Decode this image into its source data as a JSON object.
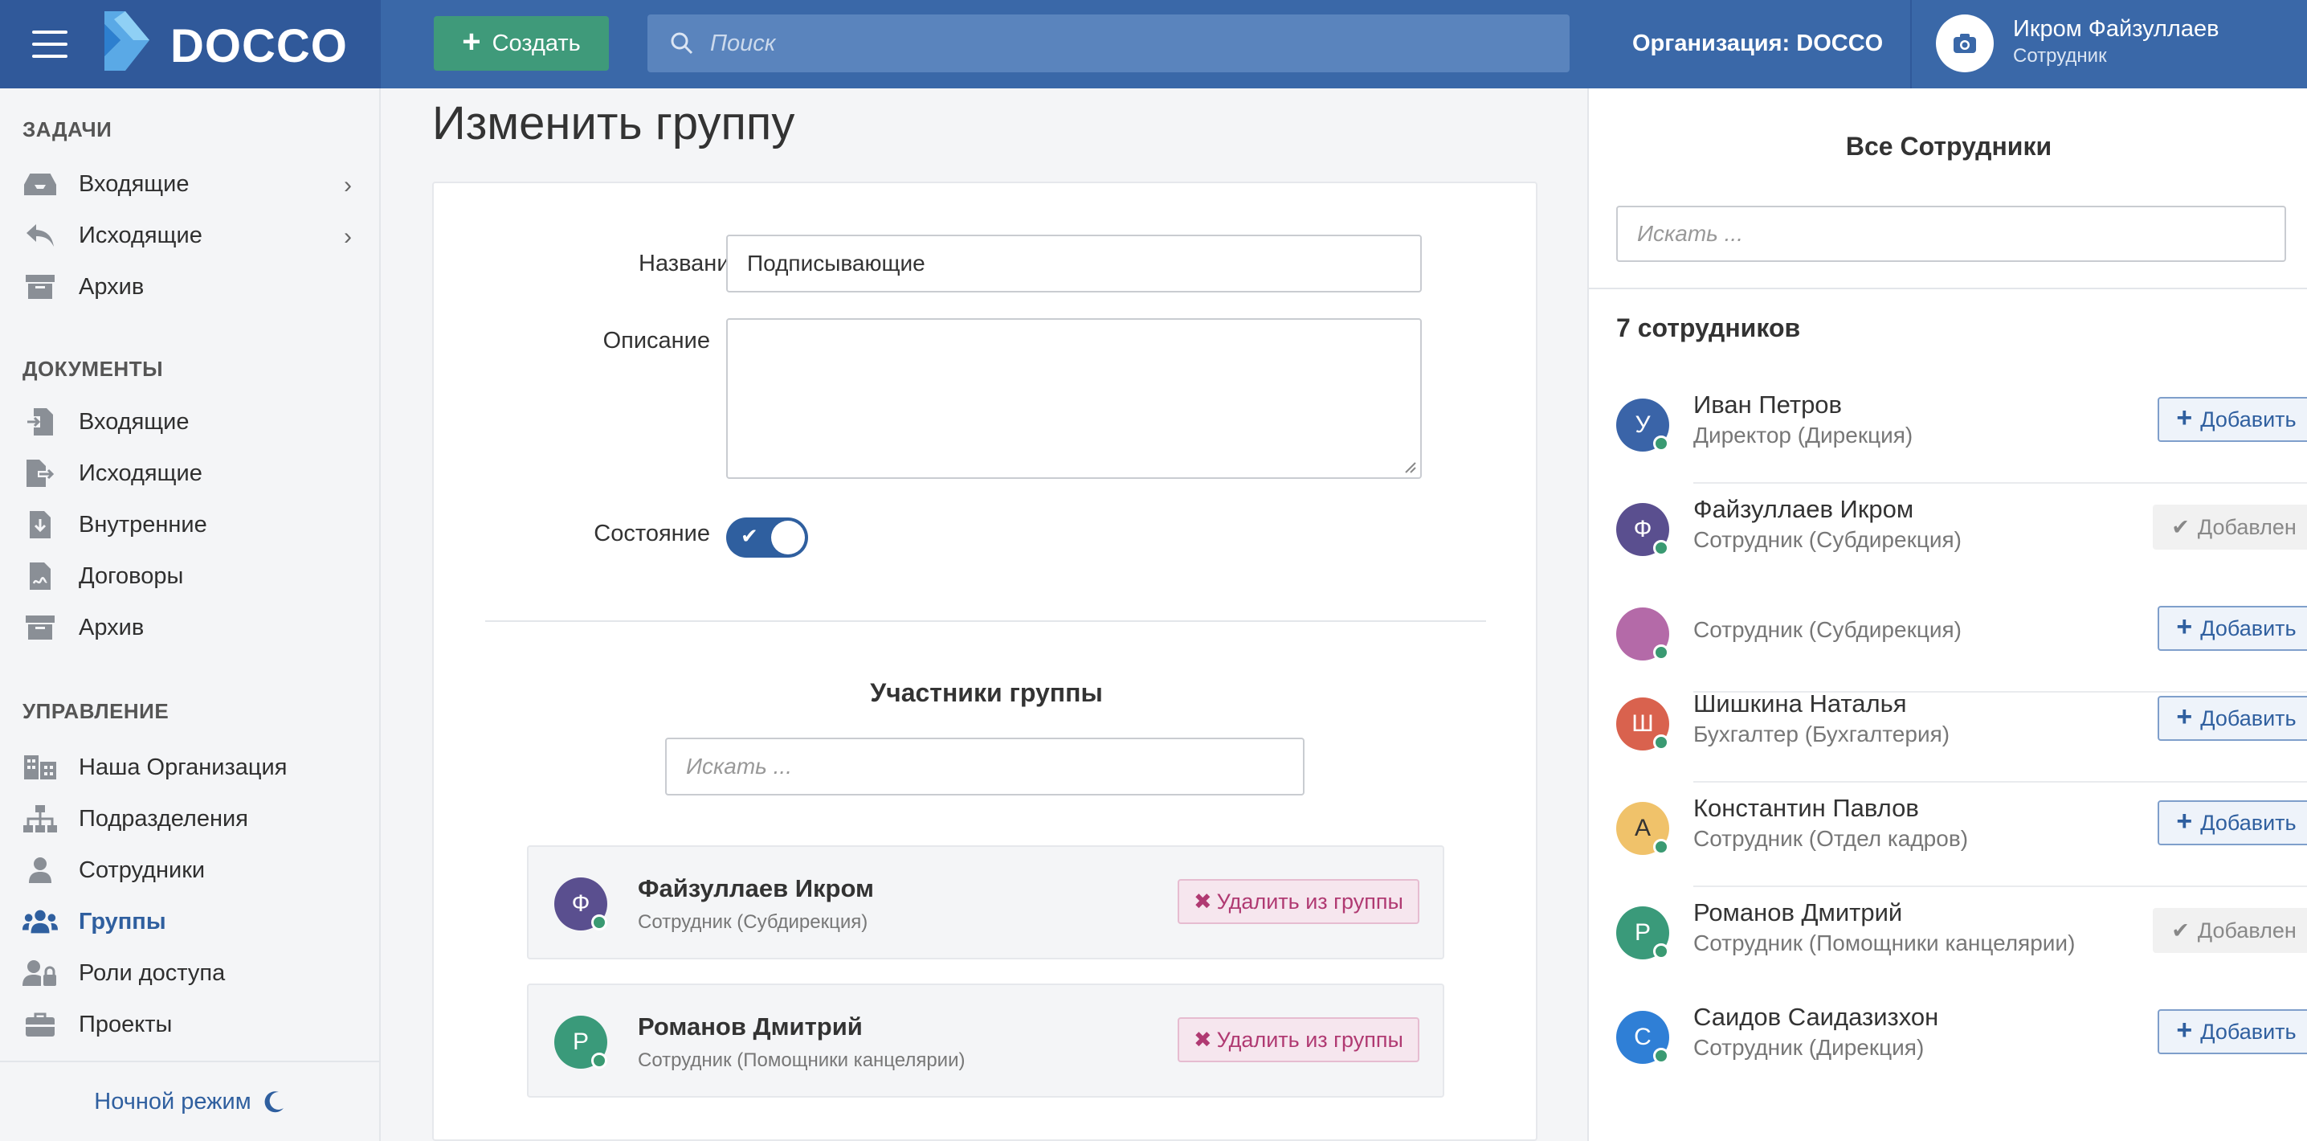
{
  "topbar": {
    "brand": "DOCCO",
    "create_label": "Создать",
    "search_placeholder": "Поиск",
    "organization": "Организация: DOCCO",
    "user_name": "Икром Файзуллаев",
    "user_role": "Сотрудник"
  },
  "sidebar": {
    "tasks_title": "ЗАДАЧИ",
    "tasks": [
      {
        "label": "Входящие",
        "icon": "inbox-icon",
        "has_chevron": true
      },
      {
        "label": "Исходящие",
        "icon": "reply-icon",
        "has_chevron": true
      },
      {
        "label": "Архив",
        "icon": "archive-icon",
        "has_chevron": false
      }
    ],
    "docs_title": "ДОКУМЕНТЫ",
    "docs": [
      {
        "label": "Входящие",
        "icon": "file-import-icon"
      },
      {
        "label": "Исходящие",
        "icon": "file-export-icon"
      },
      {
        "label": "Внутренние",
        "icon": "file-download-icon"
      },
      {
        "label": "Договоры",
        "icon": "file-signature-icon"
      },
      {
        "label": "Архив",
        "icon": "archive-icon"
      }
    ],
    "mgmt_title": "УПРАВЛЕНИЕ",
    "mgmt": [
      {
        "label": "Наша Организация",
        "icon": "building-icon"
      },
      {
        "label": "Подразделения",
        "icon": "sitemap-icon"
      },
      {
        "label": "Сотрудники",
        "icon": "user-icon"
      },
      {
        "label": "Группы",
        "icon": "users-icon",
        "active": true
      },
      {
        "label": "Роли доступа",
        "icon": "user-lock-icon"
      },
      {
        "label": "Проекты",
        "icon": "briefcase-icon"
      }
    ],
    "night_mode": "Ночной режим"
  },
  "main": {
    "page_title": "Изменить группу",
    "form": {
      "name_label": "Название",
      "name_required_mark": "*",
      "name_value": "Подписывающие",
      "description_label": "Описание",
      "description_value": "",
      "state_label": "Состояние",
      "state_on": true
    },
    "members": {
      "title": "Участники группы",
      "search_placeholder": "Искать ...",
      "remove_label": "Удалить из группы",
      "items": [
        {
          "initial": "Ф",
          "name": "Файзуллаев Икром",
          "role": "Сотрудник (Субдирекция)",
          "color": "#5a4f8f"
        },
        {
          "initial": "Р",
          "name": "Романов Дмитрий",
          "role": "Сотрудник (Помощники канцелярии)",
          "color": "#3a9a7a"
        }
      ]
    }
  },
  "right_panel": {
    "title": "Все Сотрудники",
    "search_placeholder": "Искать ...",
    "count": "7 сотрудников",
    "add_label": "Добавить",
    "added_label": "Добавлен",
    "employees": [
      {
        "initial": "У",
        "name": "Иван Петров",
        "role": "Директор (Дирекция)",
        "color": "#3a64a8",
        "added": false
      },
      {
        "initial": "Ф",
        "name": "Файзуллаев Икром",
        "role": "Сотрудник (Субдирекция)",
        "color": "#5a4f8f",
        "added": true
      },
      {
        "initial": "",
        "name": "",
        "role": "Сотрудник (Субдирекция)",
        "color": "#b46aa8",
        "added": false
      },
      {
        "initial": "Ш",
        "name": "Шишкина Наталья",
        "role": "Бухгалтер (Бухгалтерия)",
        "color": "#d9624e",
        "added": false
      },
      {
        "initial": "А",
        "name": "Константин Павлов",
        "role": "Сотрудник (Отдел кадров)",
        "color": "#f0c26a",
        "added": false
      },
      {
        "initial": "Р",
        "name": "Романов Дмитрий",
        "role": "Сотрудник (Помощники канцелярии)",
        "color": "#3a9a7a",
        "added": true
      },
      {
        "initial": "С",
        "name": "Саидов Саидазизхон",
        "role": "Сотрудник (Дирекция)",
        "color": "#2f7fd6",
        "added": false
      }
    ]
  }
}
